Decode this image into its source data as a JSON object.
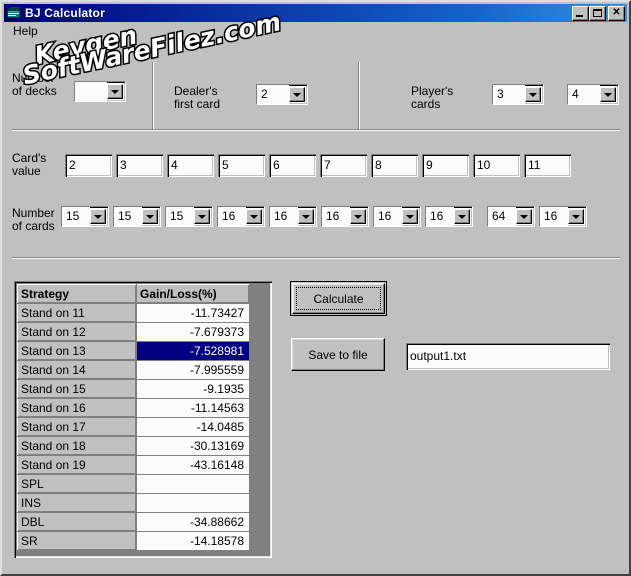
{
  "window": {
    "title": "BJ Calculator",
    "icon": "app-window-icon",
    "buttons": {
      "minimize": "Minimize",
      "maximize": "Maximize",
      "close": "Close"
    }
  },
  "menubar": {
    "items": [
      {
        "label": "Help"
      }
    ]
  },
  "watermark": {
    "line1": "Keygen",
    "line2": "SoftWareFilez.com"
  },
  "inputs": {
    "decks": {
      "label": "Number\nof decks",
      "value": ""
    },
    "dealer": {
      "label": "Dealer's\nfirst card",
      "value": "2"
    },
    "player": {
      "label": "Player's\ncards",
      "card1": "3",
      "card2": "4"
    }
  },
  "cards": {
    "value_label": "Card's\nvalue",
    "count_label": "Number\nof cards",
    "values": [
      "2",
      "3",
      "4",
      "5",
      "6",
      "7",
      "8",
      "9",
      "10",
      "11"
    ],
    "counts": [
      "15",
      "15",
      "15",
      "16",
      "16",
      "16",
      "16",
      "16",
      "64",
      "16"
    ]
  },
  "results": {
    "headers": [
      "Strategy",
      "Gain/Loss(%)"
    ],
    "selected_index": 2,
    "rows": [
      {
        "strategy": "Stand  on 11",
        "gain": "-11.73427"
      },
      {
        "strategy": "Stand  on 12",
        "gain": "-7.679373"
      },
      {
        "strategy": "Stand  on 13",
        "gain": "-7.528981"
      },
      {
        "strategy": "Stand  on 14",
        "gain": "-7.995559"
      },
      {
        "strategy": "Stand  on 15",
        "gain": "-9.1935"
      },
      {
        "strategy": "Stand  on 16",
        "gain": "-11.14563"
      },
      {
        "strategy": "Stand  on 17",
        "gain": "-14.0485"
      },
      {
        "strategy": "Stand  on 18",
        "gain": "-30.13169"
      },
      {
        "strategy": "Stand  on 19",
        "gain": "-43.16148"
      },
      {
        "strategy": "SPL",
        "gain": ""
      },
      {
        "strategy": "INS",
        "gain": ""
      },
      {
        "strategy": "DBL",
        "gain": "-34.88662"
      },
      {
        "strategy": "SR",
        "gain": "-14.18578"
      }
    ]
  },
  "actions": {
    "calculate": "Calculate",
    "save": "Save to file",
    "filename": "output1.txt",
    "filename_placeholder": "output1.txt"
  },
  "colors": {
    "face": "#c0c0c0",
    "selection": "#000080",
    "title_start": "#00007b",
    "title_end": "#3a8fe0"
  }
}
